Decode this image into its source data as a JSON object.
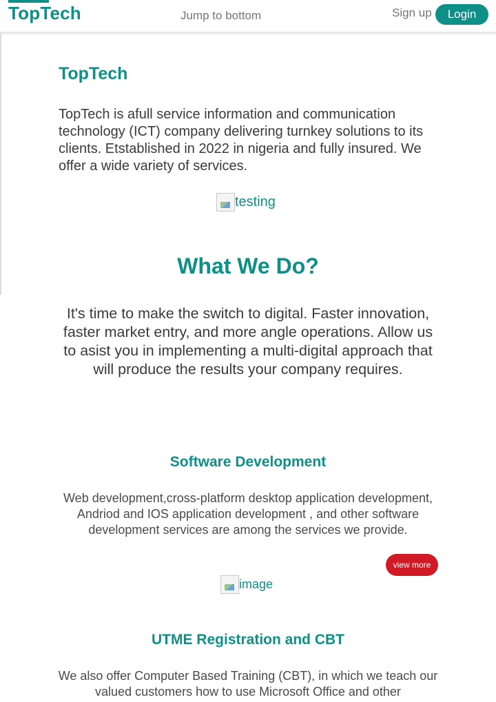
{
  "header": {
    "brand": "TopTech",
    "jump_link": "Jump to bottom",
    "signup_link": "Sign up",
    "login_button": "Login"
  },
  "intro": {
    "title": "TopTech",
    "text": "TopTech is afull service information and communication technology (ICT) company delivering turnkey solutions to its clients. Etstablished in 2022 in nigeria and fully insured. We offer a wide variety of services.",
    "image_alt": "testing"
  },
  "what_we_do": {
    "title": "What We Do?",
    "text": "It's time to make the switch to digital. Faster innovation, faster market entry, and more angle operations. Allow us to asist you in implementing a multi-digital approach that will produce the results your company requires."
  },
  "services": [
    {
      "title": "Software Development",
      "text": "Web development,cross-platform desktop application development, Andriod and IOS application development , and other software development services are among the services we provide.",
      "button": "view more",
      "image_alt": "image"
    },
    {
      "title": "UTME Registration and CBT",
      "text": "We also offer Computer Based Training (CBT), in which we teach our valued customers how to use Microsoft Office and other"
    }
  ],
  "colors": {
    "accent": "#0e8f88",
    "button_red": "#d01a25",
    "muted_text": "#757575"
  }
}
